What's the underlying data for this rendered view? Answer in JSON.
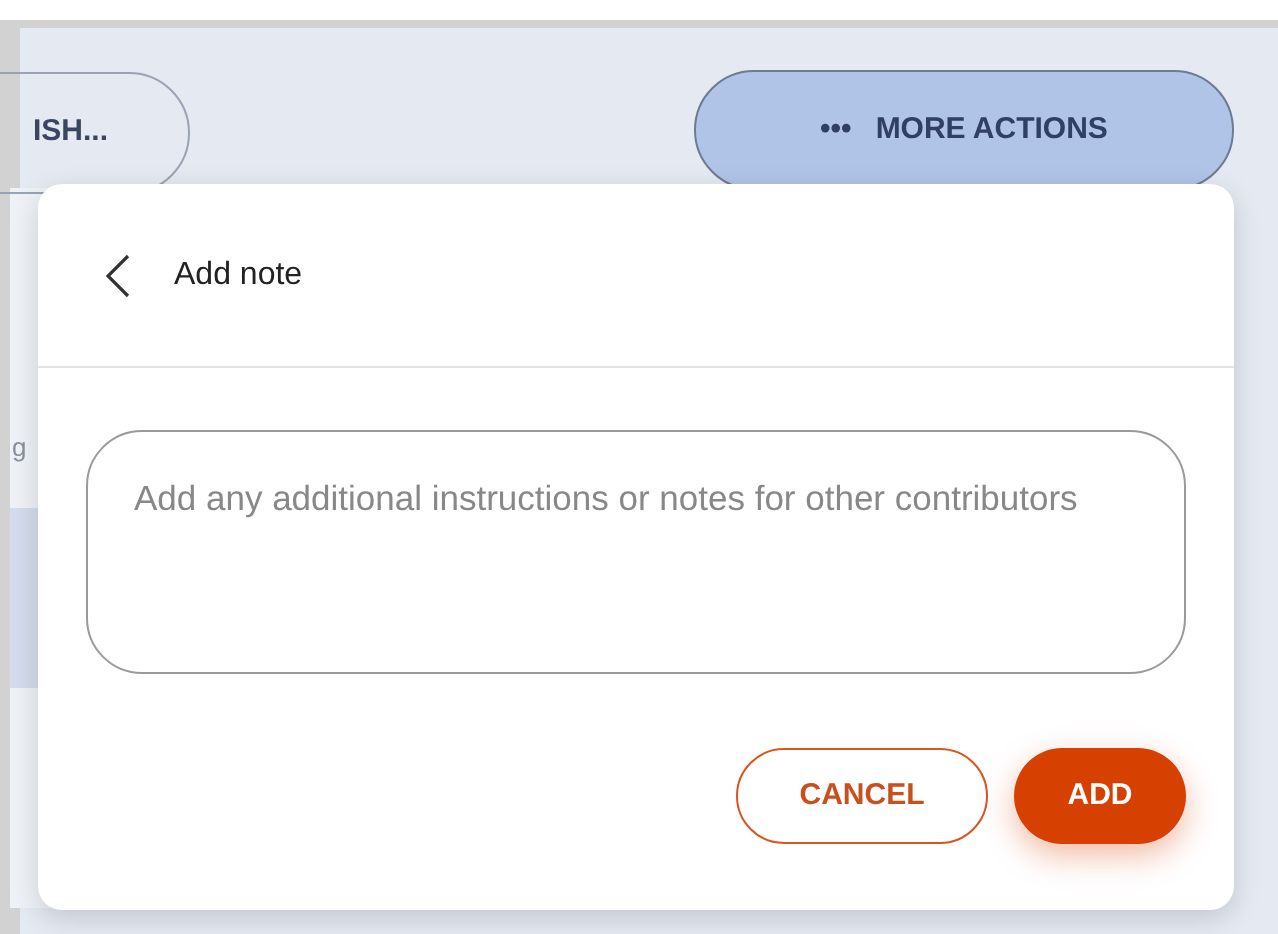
{
  "toolbar": {
    "partial_button": "ISH...",
    "more_actions": {
      "icon": "•••",
      "label": "MORE ACTIONS"
    }
  },
  "background_text": "g",
  "popover": {
    "title": "Add note",
    "note": {
      "placeholder": "Add any additional instructions or notes for other contributors"
    },
    "buttons": [
      {
        "label": "CANCEL",
        "kind": "secondary"
      },
      {
        "label": "ADD",
        "kind": "primary"
      }
    ]
  }
}
